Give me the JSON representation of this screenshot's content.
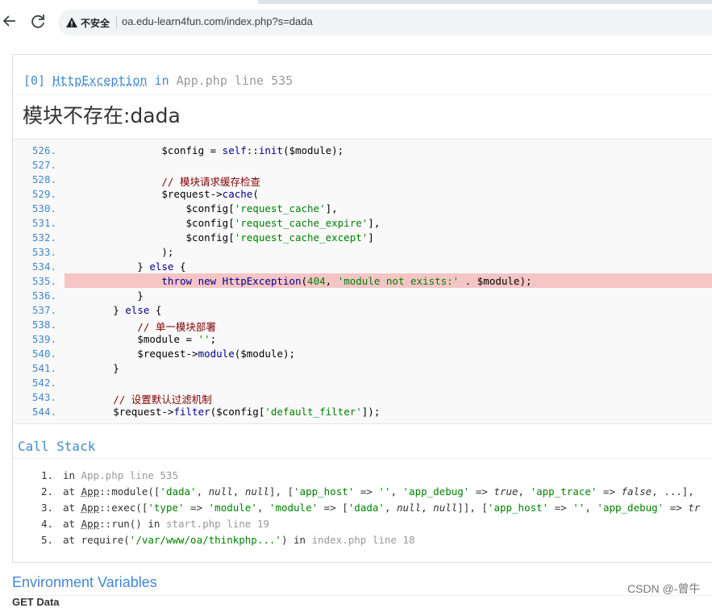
{
  "browser": {
    "security_label": "不安全",
    "url": "oa.edu-learn4fun.com/index.php?s=dada"
  },
  "exception": {
    "index": "[0]",
    "class": "HttpException",
    "in_word": "in",
    "file": "App.php",
    "line_word": "line",
    "line": "535",
    "message": "模块不存在:dada"
  },
  "source": {
    "error_line": "535.",
    "lines": [
      {
        "no": "526.",
        "parts": [
          [
            "t-var",
            "                $config = "
          ],
          [
            "t-kw",
            "self"
          ],
          [
            "t-var",
            "::"
          ],
          [
            "t-fn",
            "init"
          ],
          [
            "t-var",
            "($module);"
          ]
        ]
      },
      {
        "no": "527.",
        "parts": []
      },
      {
        "no": "528.",
        "parts": [
          [
            "t-com",
            "                // 模块请求缓存检查"
          ]
        ]
      },
      {
        "no": "529.",
        "parts": [
          [
            "t-var",
            "                $request->"
          ],
          [
            "t-fn",
            "cache"
          ],
          [
            "t-var",
            "("
          ]
        ]
      },
      {
        "no": "530.",
        "parts": [
          [
            "t-var",
            "                    $config["
          ],
          [
            "t-str",
            "'request_cache'"
          ],
          [
            "t-var",
            "],"
          ]
        ]
      },
      {
        "no": "531.",
        "parts": [
          [
            "t-var",
            "                    $config["
          ],
          [
            "t-str",
            "'request_cache_expire'"
          ],
          [
            "t-var",
            "],"
          ]
        ]
      },
      {
        "no": "532.",
        "parts": [
          [
            "t-var",
            "                    $config["
          ],
          [
            "t-str",
            "'request_cache_except'"
          ],
          [
            "t-var",
            "]"
          ]
        ]
      },
      {
        "no": "533.",
        "parts": [
          [
            "t-var",
            "                );"
          ]
        ]
      },
      {
        "no": "534.",
        "parts": [
          [
            "t-var",
            "            } "
          ],
          [
            "t-kw",
            "else"
          ],
          [
            "t-var",
            " {"
          ]
        ]
      },
      {
        "no": "535.",
        "parts": [
          [
            "t-kw",
            "                throw new "
          ],
          [
            "t-fn",
            "HttpException"
          ],
          [
            "t-var",
            "("
          ],
          [
            "t-str",
            "404"
          ],
          [
            "t-var",
            ", "
          ],
          [
            "t-str",
            "'module not exists:'"
          ],
          [
            "t-var",
            " . $module);"
          ]
        ]
      },
      {
        "no": "536.",
        "parts": [
          [
            "t-var",
            "            }"
          ]
        ]
      },
      {
        "no": "537.",
        "parts": [
          [
            "t-var",
            "        } "
          ],
          [
            "t-kw",
            "else"
          ],
          [
            "t-var",
            " {"
          ]
        ]
      },
      {
        "no": "538.",
        "parts": [
          [
            "t-com",
            "            // 单一模块部署"
          ]
        ]
      },
      {
        "no": "539.",
        "parts": [
          [
            "t-var",
            "            $module = "
          ],
          [
            "t-str",
            "''"
          ],
          [
            "t-var",
            ";"
          ]
        ]
      },
      {
        "no": "540.",
        "parts": [
          [
            "t-var",
            "            $request->"
          ],
          [
            "t-fn",
            "module"
          ],
          [
            "t-var",
            "($module);"
          ]
        ]
      },
      {
        "no": "541.",
        "parts": [
          [
            "t-var",
            "        }"
          ]
        ]
      },
      {
        "no": "542.",
        "parts": []
      },
      {
        "no": "543.",
        "parts": [
          [
            "t-com",
            "        // 设置默认过滤机制"
          ]
        ]
      },
      {
        "no": "544.",
        "parts": [
          [
            "t-var",
            "        $request->"
          ],
          [
            "t-fn",
            "filter"
          ],
          [
            "t-var",
            "($config["
          ],
          [
            "t-str",
            "'default_filter'"
          ],
          [
            "t-var",
            "]);"
          ]
        ]
      }
    ]
  },
  "call_stack": {
    "title": "Call Stack",
    "items": [
      {
        "no": "1.",
        "parts": [
          [
            "",
            "in "
          ],
          [
            "t-gray",
            "App.php line 535"
          ]
        ]
      },
      {
        "no": "2.",
        "parts": [
          [
            "",
            "at "
          ],
          [
            "t-link",
            "App"
          ],
          [
            "",
            "::module(["
          ],
          [
            "t-str",
            "'dada'"
          ],
          [
            "",
            ", "
          ],
          [
            "t-ital",
            "null"
          ],
          [
            "",
            ", "
          ],
          [
            "t-ital",
            "null"
          ],
          [
            "",
            "], ["
          ],
          [
            "t-str",
            "'app_host'"
          ],
          [
            "",
            " => "
          ],
          [
            "t-str",
            "''"
          ],
          [
            "",
            ", "
          ],
          [
            "t-str",
            "'app_debug'"
          ],
          [
            "",
            " => "
          ],
          [
            "t-ital",
            "true"
          ],
          [
            "",
            ", "
          ],
          [
            "t-str",
            "'app_trace'"
          ],
          [
            "",
            " => "
          ],
          [
            "t-ital",
            "false"
          ],
          [
            "",
            ", ...],"
          ]
        ]
      },
      {
        "no": "3.",
        "parts": [
          [
            "",
            "at "
          ],
          [
            "t-link",
            "App"
          ],
          [
            "",
            "::exec(["
          ],
          [
            "t-str",
            "'type'"
          ],
          [
            "",
            " => "
          ],
          [
            "t-str",
            "'module'"
          ],
          [
            "",
            ", "
          ],
          [
            "t-str",
            "'module'"
          ],
          [
            "",
            " => ["
          ],
          [
            "t-str",
            "'dada'"
          ],
          [
            "",
            ", "
          ],
          [
            "t-ital",
            "null"
          ],
          [
            "",
            ", "
          ],
          [
            "t-ital",
            "null"
          ],
          [
            "",
            "]], ["
          ],
          [
            "t-str",
            "'app_host'"
          ],
          [
            "",
            " => "
          ],
          [
            "t-str",
            "''"
          ],
          [
            "",
            ", "
          ],
          [
            "t-str",
            "'app_debug'"
          ],
          [
            "",
            " => "
          ],
          [
            "t-ital",
            "tr"
          ]
        ]
      },
      {
        "no": "4.",
        "parts": [
          [
            "",
            "at "
          ],
          [
            "t-link",
            "App"
          ],
          [
            "",
            "::run() in "
          ],
          [
            "t-gray",
            "start.php line 19"
          ]
        ]
      },
      {
        "no": "5.",
        "parts": [
          [
            "",
            "at require("
          ],
          [
            "t-str",
            "'/var/www/oa/thinkphp...'"
          ],
          [
            "",
            ") in "
          ],
          [
            "t-gray",
            "index.php line 18"
          ]
        ]
      }
    ]
  },
  "env": {
    "title": "Environment Variables",
    "first_row": "GET Data"
  },
  "watermark": "CSDN @-曾牛",
  "colors": {
    "accent": "#4288ce",
    "error_highlight": "#f5c5c5"
  }
}
